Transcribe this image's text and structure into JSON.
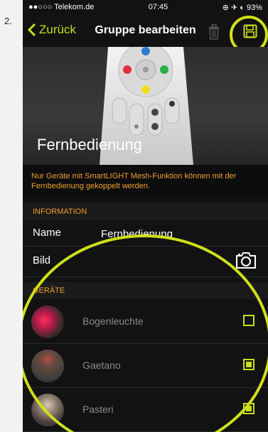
{
  "step": "2.",
  "status": {
    "carrier": "●●○○○ Telekom.de",
    "time": "07:45",
    "indicators": "⊕ ✈ ◐ 93%"
  },
  "nav": {
    "back_label": "Zurück",
    "title": "Gruppe bearbeiten",
    "trash_icon": "trash-icon",
    "save_icon": "floppy-disk-icon"
  },
  "hero": {
    "title": "Fernbedienung"
  },
  "notice": "Nur Geräte mit SmartLIGHT Mesh-Funktion können mit der Fernbedienung gekoppelt werden.",
  "information": {
    "header": "INFORMATION",
    "name_label": "Name",
    "name_value": "Fernbedienung",
    "image_label": "Bild",
    "camera_icon": "camera-icon"
  },
  "devices": {
    "header": "GERÄTE",
    "items": [
      {
        "name": "Bogenleuchte",
        "checked": false
      },
      {
        "name": "Gaetano",
        "checked": true
      },
      {
        "name": "Pasteri",
        "checked": true
      }
    ]
  },
  "colors": {
    "accent": "#c8dd1e",
    "notice": "#f0a030",
    "background": "#121212",
    "highlight_ring": "#cfe01a"
  }
}
